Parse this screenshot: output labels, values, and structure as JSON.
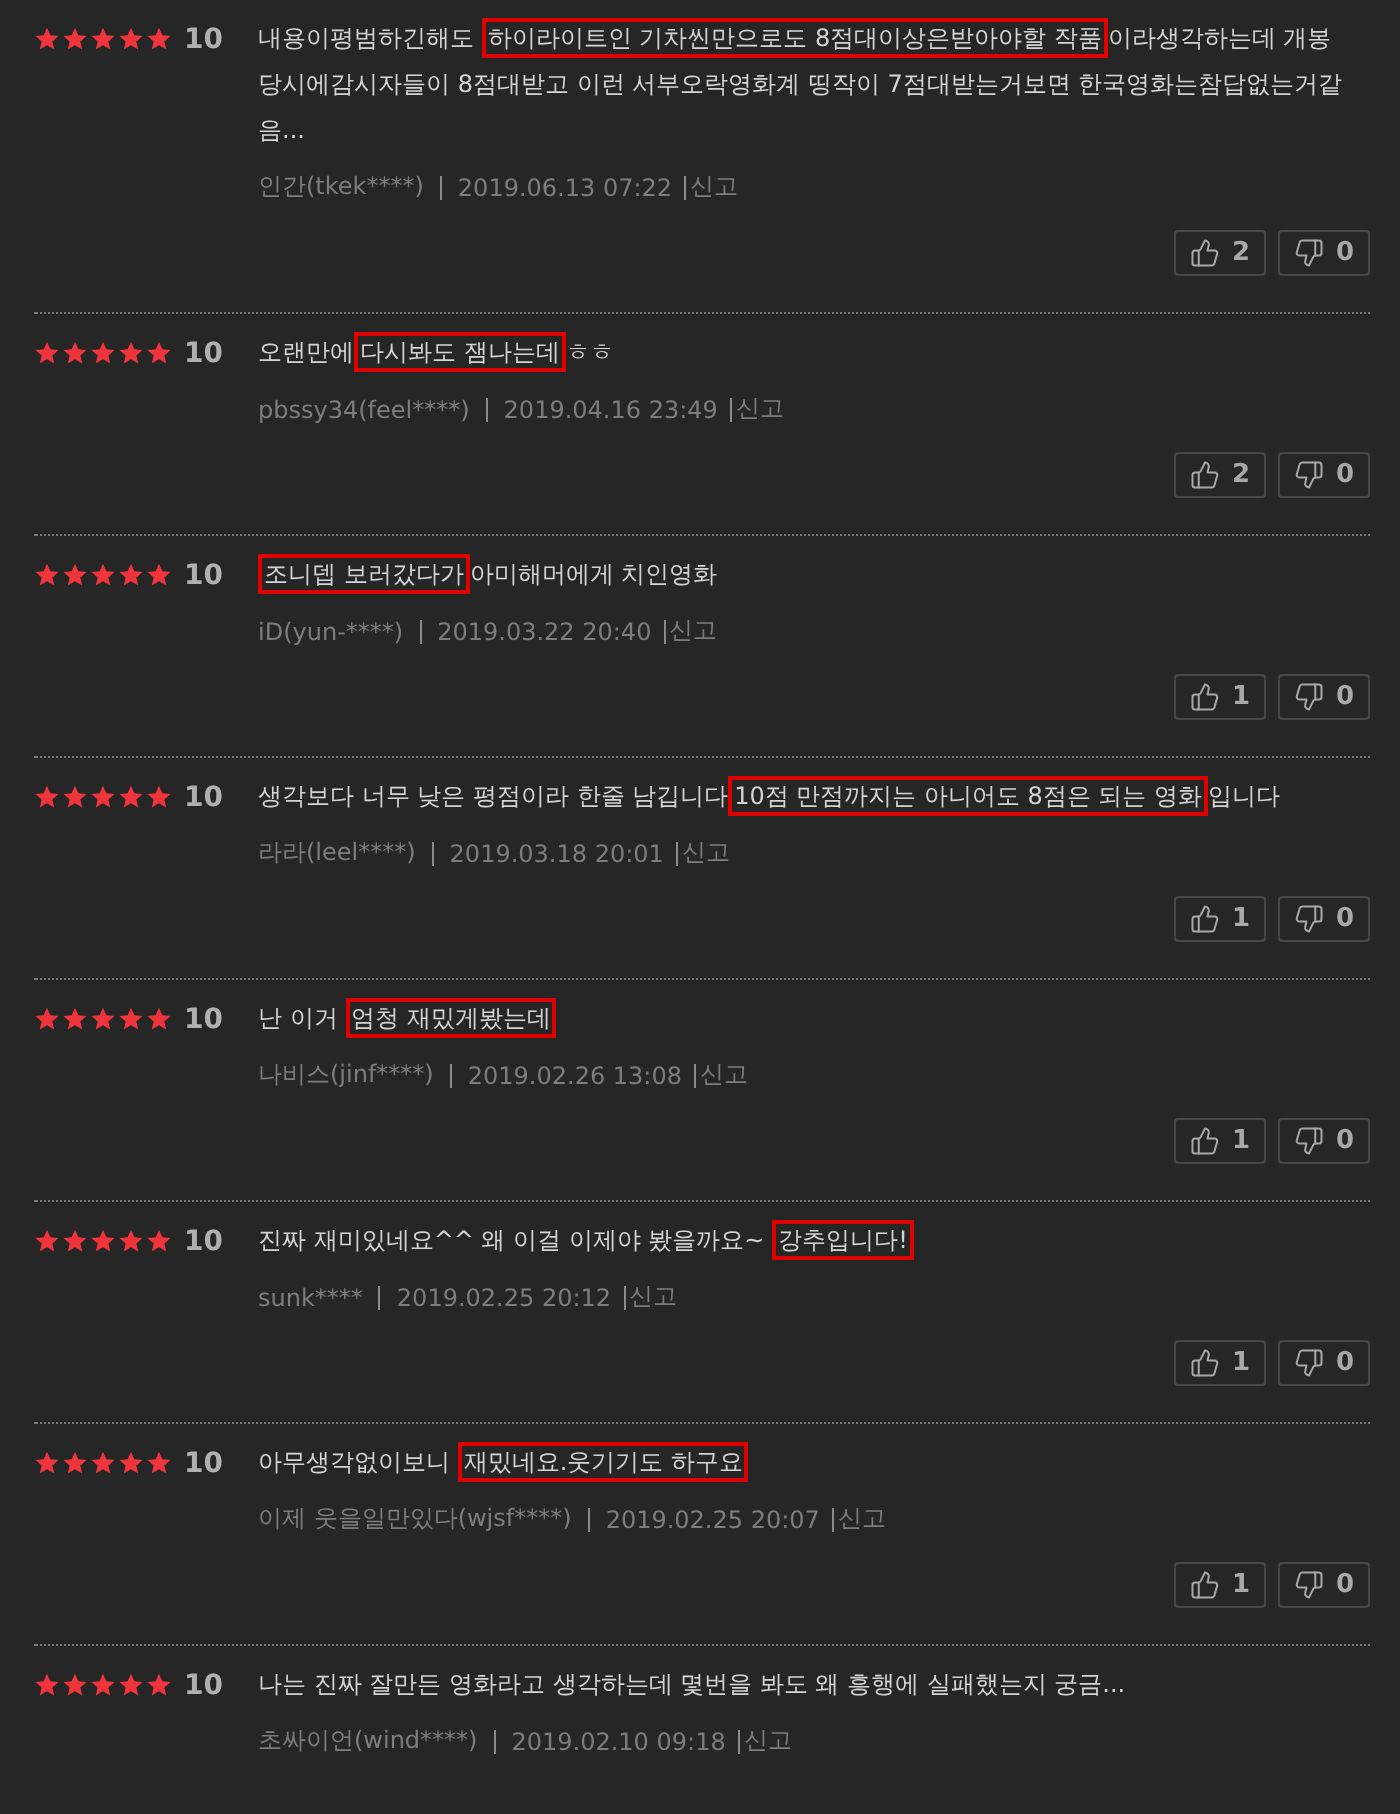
{
  "reviews": [
    {
      "stars": 5,
      "score": "10",
      "segments": [
        {
          "text": "내용이평범하긴해도 ",
          "highlighted": false
        },
        {
          "text": "하이라이트인 기차씬만으로도 8점대이상은받아야할 작품",
          "highlighted": true
        },
        {
          "text": "이라생각하는데 개봉당시에감시자들이 8점대받고 이런 서부오락영화계 띵작이 7점대받는거보면 한국영화는참답없는거같음...",
          "highlighted": false
        }
      ],
      "author": "인간(tkek****)",
      "date": "2019.06.13 07:22",
      "report": "신고",
      "likes": "2",
      "dislikes": "0"
    },
    {
      "stars": 5,
      "score": "10",
      "segments": [
        {
          "text": "오랜만에",
          "highlighted": false
        },
        {
          "text": "다시봐도 잼나는데",
          "highlighted": true
        },
        {
          "text": "ㅎㅎ",
          "highlighted": false
        }
      ],
      "author": "pbssy34(feel****)",
      "date": "2019.04.16 23:49",
      "report": "신고",
      "likes": "2",
      "dislikes": "0"
    },
    {
      "stars": 5,
      "score": "10",
      "segments": [
        {
          "text": "조니뎁 보러갔다가",
          "highlighted": true
        },
        {
          "text": "아미해머에게 치인영화",
          "highlighted": false
        }
      ],
      "author": "iD(yun-****)",
      "date": "2019.03.22 20:40",
      "report": "신고",
      "likes": "1",
      "dislikes": "0"
    },
    {
      "stars": 5,
      "score": "10",
      "segments": [
        {
          "text": "생각보다 너무 낮은 평점이라 한줄 남깁니다",
          "highlighted": false
        },
        {
          "text": "10점 만점까지는 아니어도 8점은 되는 영화",
          "highlighted": true
        },
        {
          "text": "입니다",
          "highlighted": false
        }
      ],
      "author": "라라(leel****)",
      "date": "2019.03.18 20:01",
      "report": "신고",
      "likes": "1",
      "dislikes": "0"
    },
    {
      "stars": 5,
      "score": "10",
      "segments": [
        {
          "text": "난 이거 ",
          "highlighted": false
        },
        {
          "text": "엄청 재밌게봤는데",
          "highlighted": true
        }
      ],
      "author": "나비스(jinf****)",
      "date": "2019.02.26 13:08",
      "report": "신고",
      "likes": "1",
      "dislikes": "0"
    },
    {
      "stars": 5,
      "score": "10",
      "segments": [
        {
          "text": "진짜 재미있네요^^ 왜 이걸 이제야 봤을까요~ ",
          "highlighted": false
        },
        {
          "text": "강추입니다!",
          "highlighted": true
        }
      ],
      "author": "sunk****",
      "date": "2019.02.25 20:12",
      "report": "신고",
      "likes": "1",
      "dislikes": "0"
    },
    {
      "stars": 5,
      "score": "10",
      "segments": [
        {
          "text": "아무생각없이보니 ",
          "highlighted": false
        },
        {
          "text": "재밌네요.웃기기도 하구요",
          "highlighted": true
        }
      ],
      "author": "이제 웃을일만있다(wjsf****)",
      "date": "2019.02.25 20:07",
      "report": "신고",
      "likes": "1",
      "dislikes": "0"
    },
    {
      "stars": 5,
      "score": "10",
      "segments": [
        {
          "text": "나는 진짜 잘만든 영화라고 생각하는데 몇번을 봐도 왜 흥행에 실패했는지 궁금...",
          "highlighted": false
        }
      ],
      "author": "초싸이언(wind****)",
      "date": "2019.02.10 09:18",
      "report": "신고"
    }
  ]
}
